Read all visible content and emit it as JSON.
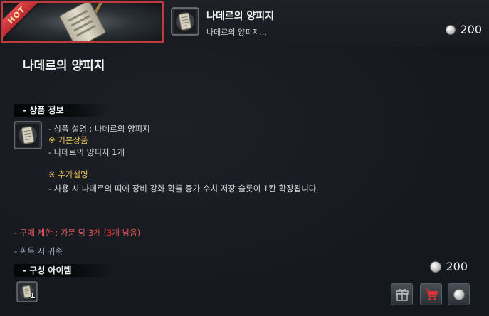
{
  "header": {
    "badge": "HOT",
    "title": "나데르의 양피지",
    "subtitle": "나데르의 양피지...",
    "price": "200"
  },
  "product": {
    "title": "나데르의 양피지",
    "info_section": "- 상품 정보",
    "description": [
      "- 상품 설명 : 나데르의 양피지",
      "※ 기본상품",
      "- 나데르의 양피지 1개",
      "※ 추가설명",
      "- 사용 시 나데르의 띠에 장비 강화 확률 증가 수치 저장 슬롯이 1칸 확장됩니다."
    ],
    "purchase_limit": {
      "prefix": "- 구매 제한 : 가문 당 3개 (",
      "remaining_count": "3",
      "suffix": "개 남음)"
    },
    "bind_note": "- 획득 시 귀속",
    "composition_section": "- 구성 아이템",
    "composition_items": [
      {
        "icon": "scroll-icon",
        "quantity": "1"
      }
    ],
    "price": "200"
  },
  "icons": {
    "currency": "silver-coin-icon",
    "gift": "gift-icon",
    "cart": "cart-icon",
    "buy": "silver-coin-icon"
  },
  "colors": {
    "background": "#15181d",
    "hot_badge": "#c8363a",
    "gold_text": "#e8c25a",
    "limit_text": "#e05a5a",
    "bind_text": "#a4b3c6",
    "cart_icon": "#d8323a"
  }
}
